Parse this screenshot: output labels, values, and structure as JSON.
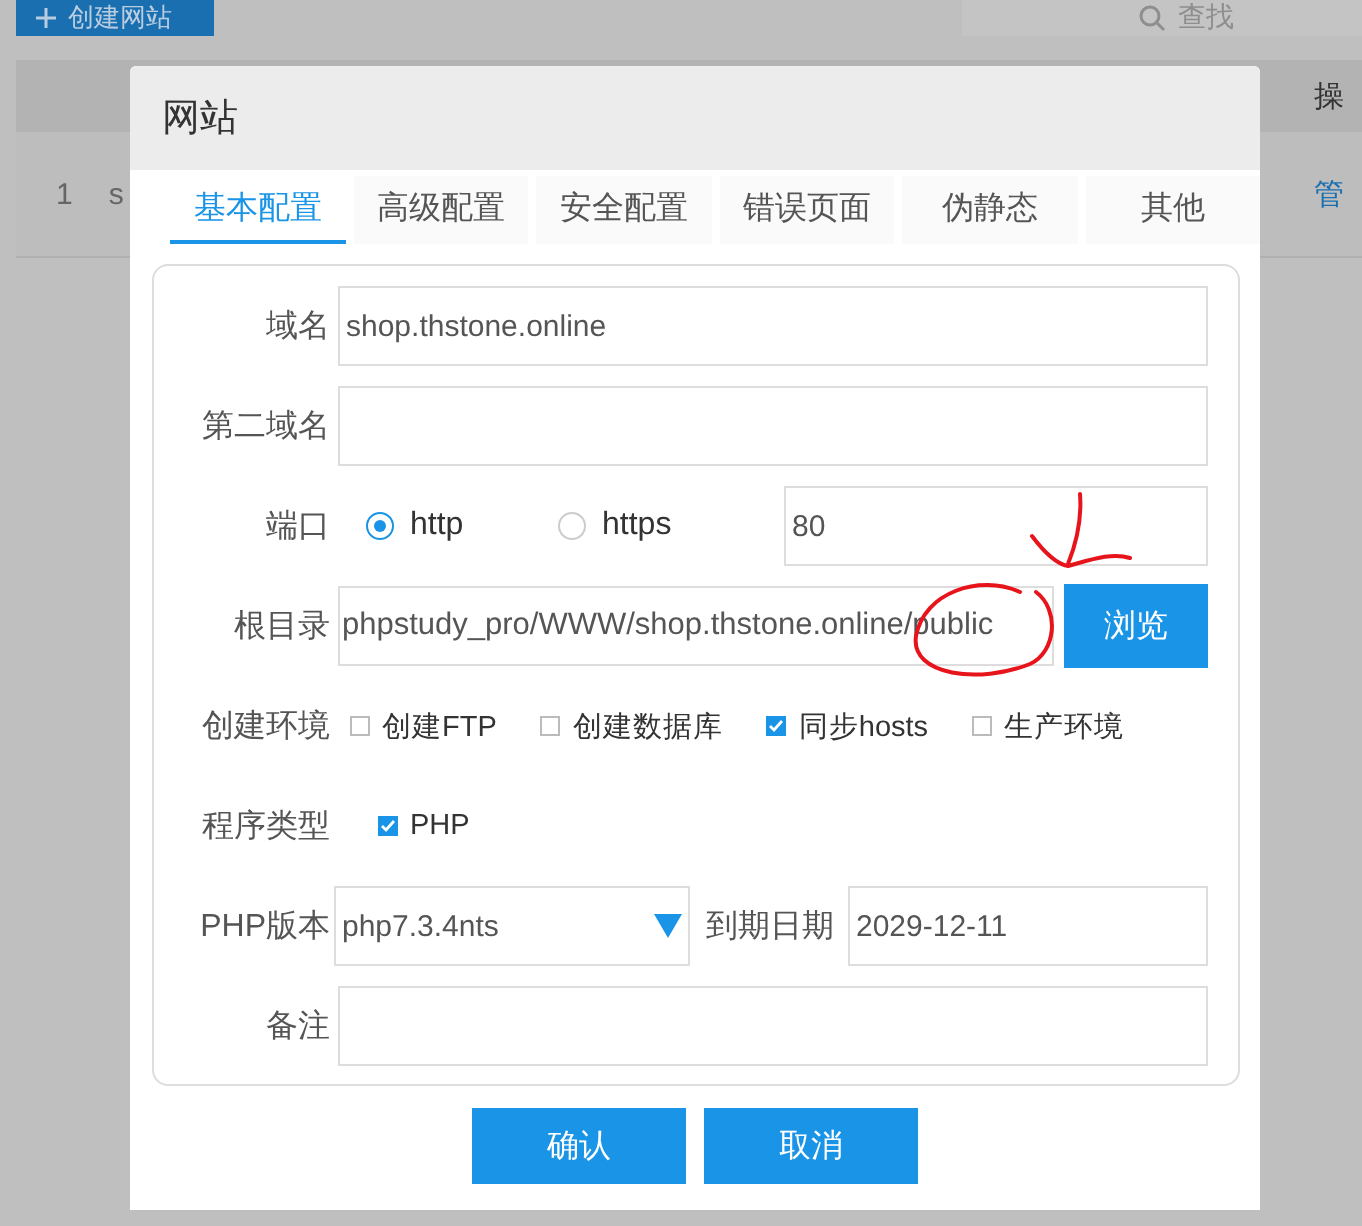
{
  "background": {
    "create_button": "创建网站",
    "search": {
      "placeholder": "查找"
    },
    "table": {
      "columns": [
        "操"
      ],
      "rows": [
        {
          "index": "1",
          "column_2": "s",
          "action": "管"
        }
      ]
    }
  },
  "dialog": {
    "title": "网站",
    "tabs": [
      {
        "label": "基本配置",
        "selected": true
      },
      {
        "label": "高级配置",
        "selected": false
      },
      {
        "label": "安全配置",
        "selected": false
      },
      {
        "label": "错误页面",
        "selected": false
      },
      {
        "label": "伪静态",
        "selected": false
      },
      {
        "label": "其他",
        "selected": false
      }
    ],
    "form": {
      "domain": {
        "label": "域名",
        "value": "shop.thstone.online"
      },
      "second_domain": {
        "label": "第二域名"
      },
      "port": {
        "label": "端口",
        "options": [
          {
            "label": "http",
            "selected": true
          },
          {
            "label": "https",
            "selected": false
          }
        ],
        "value": "80"
      },
      "root": {
        "label": "根目录",
        "value": "phpstudy_pro/WWW/shop.thstone.online/public",
        "button": "浏览"
      },
      "environment": {
        "label": "创建环境",
        "options": [
          {
            "label": "创建FTP",
            "checked": false
          },
          {
            "label": "创建数据库",
            "checked": false
          },
          {
            "label": "同步hosts",
            "checked": true
          },
          {
            "label": "生产环境",
            "checked": false
          }
        ]
      },
      "program_type": {
        "label": "程序类型",
        "options": [
          {
            "label": "PHP",
            "checked": true
          }
        ]
      },
      "php_version": {
        "label": "PHP版本",
        "value": "php7.3.4nts"
      },
      "expiry": {
        "label": "到期日期",
        "value": "2029-12-11"
      },
      "note": {
        "label": "备注"
      }
    },
    "buttons": [
      "确认",
      "取消"
    ]
  }
}
